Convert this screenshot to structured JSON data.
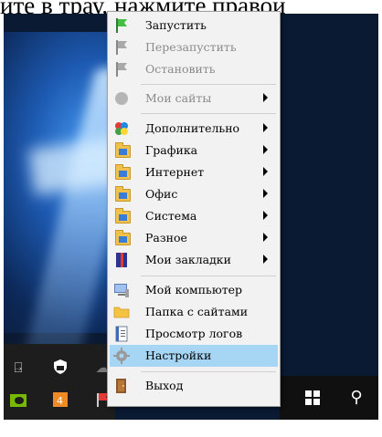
{
  "header_text": "ите в трау, нажмите правой",
  "menu": {
    "items": [
      {
        "label": "Запустить",
        "icon": "flag-green-icon",
        "disabled": false,
        "submenu": false
      },
      {
        "label": "Перезапустить",
        "icon": "flag-gray-icon",
        "disabled": true,
        "submenu": false
      },
      {
        "label": "Остановить",
        "icon": "flag-gray-icon",
        "disabled": true,
        "submenu": false
      },
      {
        "label": "Мои сайты",
        "icon": "gray-circle-icon",
        "disabled": true,
        "submenu": true
      },
      {
        "label": "Дополнительно",
        "icon": "additional-icon",
        "disabled": false,
        "submenu": true
      },
      {
        "label": "Графика",
        "icon": "folder-app-icon",
        "disabled": false,
        "submenu": true
      },
      {
        "label": "Интернет",
        "icon": "folder-app-icon",
        "disabled": false,
        "submenu": true
      },
      {
        "label": "Офис",
        "icon": "folder-app-icon",
        "disabled": false,
        "submenu": true
      },
      {
        "label": "Система",
        "icon": "folder-app-icon",
        "disabled": false,
        "submenu": true
      },
      {
        "label": "Разное",
        "icon": "folder-app-icon",
        "disabled": false,
        "submenu": true
      },
      {
        "label": "Мои закладки",
        "icon": "bookmark-book-icon",
        "disabled": false,
        "submenu": true
      },
      {
        "label": "Мой компьютер",
        "icon": "computer-icon",
        "disabled": false,
        "submenu": false
      },
      {
        "label": "Папка с сайтами",
        "icon": "folder-icon",
        "disabled": false,
        "submenu": false
      },
      {
        "label": "Просмотр логов",
        "icon": "log-icon",
        "disabled": false,
        "submenu": false
      },
      {
        "label": "Настройки",
        "icon": "gear-icon",
        "disabled": false,
        "submenu": false,
        "highlighted": true
      },
      {
        "label": "Выход",
        "icon": "exit-door-icon",
        "disabled": false,
        "submenu": false
      }
    ]
  },
  "colors": {
    "menu_bg": "#f2f2f2",
    "highlight": "#a7d6f4",
    "disabled_text": "#8a8a8a",
    "desktop_bg": "#0b1a33"
  }
}
